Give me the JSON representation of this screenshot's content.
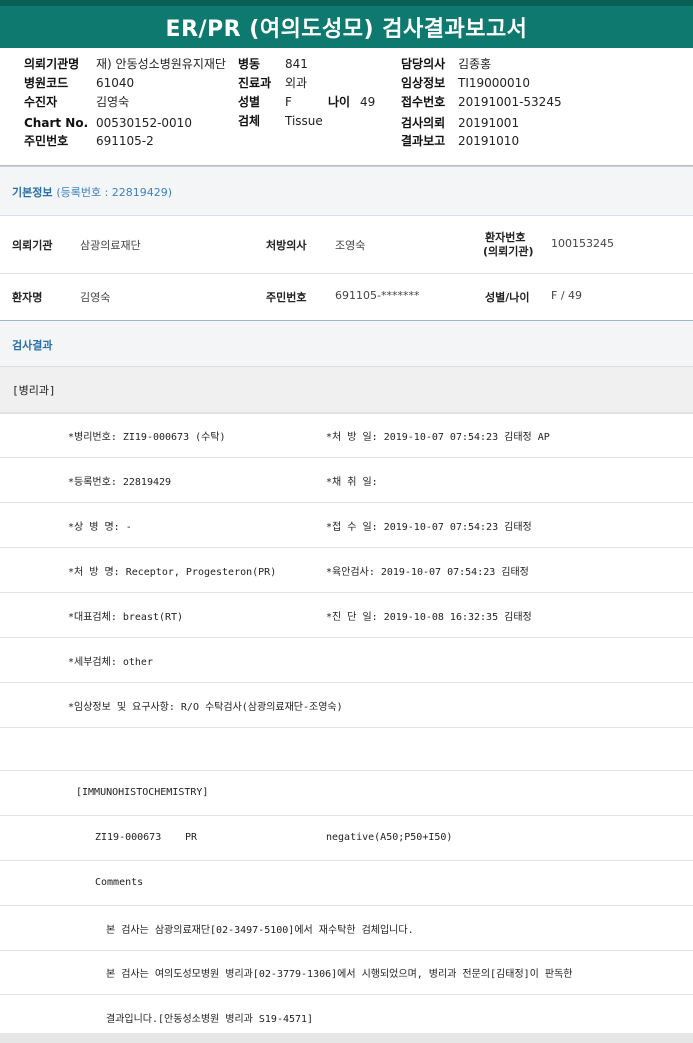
{
  "title": "ER/PR (여의도성모) 검사결과보고서",
  "header": {
    "col1": [
      {
        "label": "의뢰기관명",
        "value": "재) 안동성소병원유지재단"
      },
      {
        "label": "병원코드",
        "value": "61040"
      },
      {
        "label": "수진자",
        "value": "김영숙"
      },
      {
        "label": "Chart No.",
        "value": "00530152-0010"
      },
      {
        "label": "주민번호",
        "value": "691105-2"
      }
    ],
    "col2": [
      {
        "label": "병동",
        "value": "841"
      },
      {
        "label": "진료과",
        "value": "외과"
      },
      {
        "label": "성별",
        "value": "F"
      },
      {
        "label": "검체",
        "value": "Tissue"
      }
    ],
    "age": {
      "label": "나이",
      "value": "49"
    },
    "col3": [
      {
        "label": "담당의사",
        "value": "김종홍"
      },
      {
        "label": "임상정보",
        "value": "TI19000010"
      },
      {
        "label": "접수번호",
        "value": "20191001-53245"
      },
      {
        "label": "검사의뢰",
        "value": "20191001"
      },
      {
        "label": "결과보고",
        "value": "20191010"
      }
    ]
  },
  "basic": {
    "title": "기본정보",
    "reg": "(등록번호 : 22819429)",
    "row1": {
      "l1": "의뢰기관",
      "v1": "삼광의료재단",
      "l2": "처방의사",
      "v2": "조영숙",
      "l3a": "환자번호",
      "l3b": "(의뢰기관)",
      "v3": "100153245"
    },
    "row2": {
      "l1": "환자명",
      "v1": "김영숙",
      "l2": "주민번호",
      "v2": "691105-*******",
      "l3": "성별/나이",
      "v3": "F / 49"
    }
  },
  "result": {
    "title": "검사결과",
    "dept": "[병리과]",
    "lines": [
      {
        "left": "*병리번호: ZI19-000673 (수탁)",
        "right": "*처 방 일: 2019-10-07 07:54:23  김태정 AP"
      },
      {
        "left": "*등록번호: 22819429",
        "right": "*채 취 일:"
      },
      {
        "left": "*상 병 명: -",
        "right": "*접 수 일: 2019-10-07 07:54:23  김태정"
      },
      {
        "left": "*처 방 명: Receptor, Progesteron(PR)",
        "right": "*육안검사: 2019-10-07 07:54:23  김태정"
      },
      {
        "left": "*대표검체: breast(RT)",
        "right": "*진 단 일: 2019-10-08 16:32:35  김태정"
      },
      {
        "left": "*세부검체: other",
        "right": ""
      },
      {
        "left": "*임상정보 및 요구사항: R/O 수탁검사(삼광의료재단-조영숙)",
        "right": ""
      }
    ],
    "ihc": "[IMMUNOHISTOCHEMISTRY]",
    "ihc_row": {
      "id": "ZI19-000673",
      "marker": "PR",
      "result": "negative(A50;P50+I50)"
    },
    "comments": "Comments",
    "comment1": "본 검사는 삼광의료재단[02-3497-5100]에서 재수탁한 검체입니다.",
    "comment2": "본 검사는 여의도성모병원 병리과[02-3779-1306]에서 시행되었으며, 병리과 전문의[김태정]이 판독한",
    "comment3": "결과입니다.[안동성소병원 병리과 S19-4571]"
  }
}
